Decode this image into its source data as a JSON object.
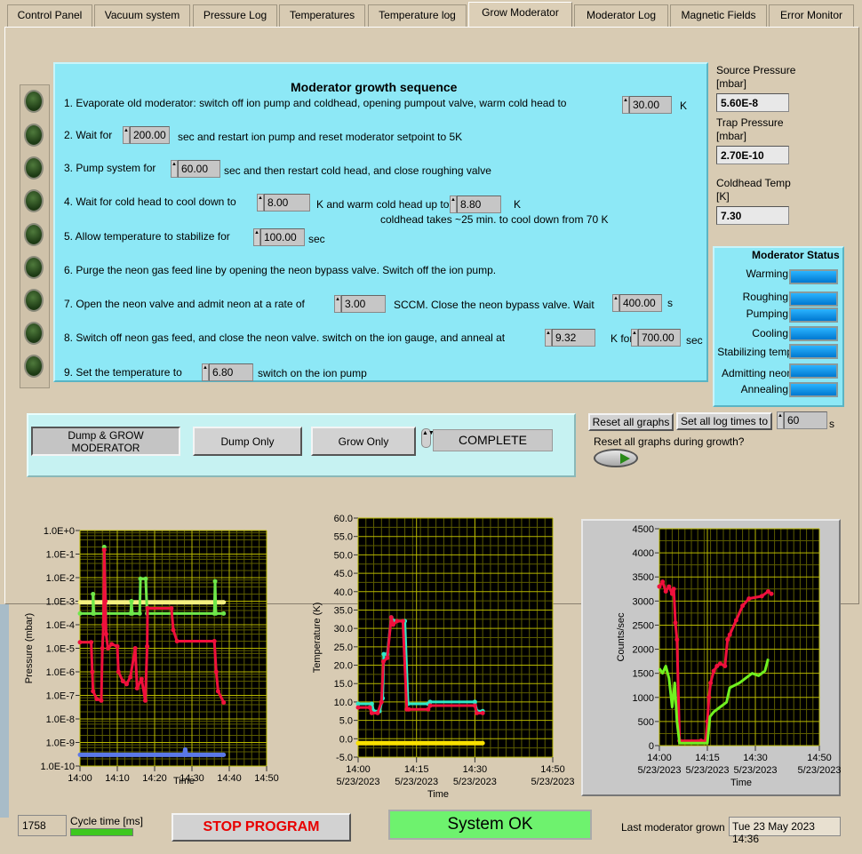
{
  "tabs": [
    "Control Panel",
    "Vacuum system",
    "Pressure Log",
    "Temperatures",
    "Temperature log",
    "Grow Moderator",
    "Moderator Log",
    "Magnetic Fields",
    "Error Monitor"
  ],
  "selected_tab": "Grow Moderator",
  "sequence": {
    "title": "Moderator growth sequence",
    "s1": {
      "text": "1. Evaporate old moderator: switch off ion pump and coldhead,  opening pumpout valve,  warm cold head to",
      "value": "30.00",
      "unit": "K"
    },
    "s2": {
      "text": "2. Wait for",
      "value": "200.00",
      "after": "sec and restart ion pump and reset moderator setpoint to 5K"
    },
    "s3": {
      "text": "3. Pump system for",
      "value": "60.00",
      "after": "sec and then restart cold head, and close roughing valve"
    },
    "s4": {
      "text": "4. Wait for cold head to cool down to",
      "value": "8.00",
      "mid": "K and warm cold head up to",
      "value2": "8.80",
      "unit": "K",
      "note": "coldhead takes ~25 min. to cool down from 70 K"
    },
    "s5": {
      "text": "5. Allow temperature to stabilize for",
      "value": "100.00",
      "unit": "sec"
    },
    "s6": {
      "text": "6. Purge the neon gas feed line by opening the neon bypass valve. Switch off the ion pump."
    },
    "s7": {
      "text": "7. Open the neon  valve and admit neon at a rate of",
      "value": "3.00",
      "mid": "SCCM. Close the neon bypass valve. Wait",
      "value2": "400.00",
      "unit": "s"
    },
    "s8": {
      "text": "8. Switch off neon gas feed, and close the neon valve. switch on the ion gauge, and anneal at",
      "value": "9.32",
      "mid": "K for",
      "value2": "700.00",
      "unit": "sec"
    },
    "s9": {
      "text": "9. Set the temperature to",
      "value": "6.80",
      "after": "switch on the ion pump"
    }
  },
  "readouts": {
    "source_label": "Source Pressure [mbar]",
    "source_value": "5.60E-8",
    "trap_label": "Trap Pressure [mbar]",
    "trap_value": "2.70E-10",
    "coldhead_label": "Coldhead Temp [K]",
    "coldhead_value": "7.30"
  },
  "status": {
    "title": "Moderator Status",
    "items": [
      "Warming",
      "Roughing",
      "Pumping",
      "Cooling",
      "Stabilizing temp",
      "Admitting neon",
      "Annealing"
    ],
    "color": "#1a9cf0"
  },
  "controls": {
    "dump_grow": "Dump & GROW MODERATOR",
    "dump_only": "Dump Only",
    "grow_only": "Grow Only",
    "state": "COMPLETE",
    "reset_graphs": "Reset  all graphs",
    "set_log_times": "Set all log times to",
    "log_time": "60",
    "log_unit": "s",
    "reset_during_growth": "Reset all graphs during growth?"
  },
  "footer": {
    "cycle_value": "1758",
    "cycle_label": "Cycle time [ms]",
    "stop": "STOP PROGRAM",
    "system_status": "System OK",
    "last_label": "Last moderator grown",
    "last_value": "Tue 23 May 2023 14:36"
  },
  "chart_data": [
    {
      "type": "line",
      "ylabel": "Pressure (mbar)",
      "xlabel": "Time",
      "yscale": "log",
      "ylim": [
        1e-10,
        1
      ],
      "xlim": [
        0,
        50
      ],
      "xticks": [
        "14:00",
        "14:10",
        "14:20",
        "14:30",
        "14:40",
        "14:50"
      ],
      "yticks": [
        "1.0E-10",
        "1.0E-9",
        "1.0E-8",
        "1.0E-7",
        "1.0E-6",
        "1.0E-5",
        "1.0E-4",
        "1.0E-3",
        "1.0E-2",
        "1.0E-1",
        "1.0E+0"
      ],
      "x_unit": "minutes after 14:00",
      "series": [
        {
          "name": "yellow",
          "color": "#f4f080",
          "points": [
            [
              0,
              0.0009
            ],
            [
              38.5,
              0.0009
            ]
          ]
        },
        {
          "name": "green",
          "color": "#6ee84a",
          "points": [
            [
              0,
              0.0003
            ],
            [
              3.5,
              0.0003
            ],
            [
              3.5,
              0.002
            ],
            [
              3.7,
              0.0003
            ],
            [
              6.4,
              0.0003
            ],
            [
              6.5,
              0.2
            ],
            [
              6.9,
              0.0003
            ],
            [
              13.6,
              0.0003
            ],
            [
              13.8,
              0.001
            ],
            [
              14,
              0.0003
            ],
            [
              16,
              0.0003
            ],
            [
              16.2,
              0.009
            ],
            [
              17.6,
              0.009
            ],
            [
              18,
              0.0003
            ],
            [
              36,
              0.0003
            ],
            [
              36.2,
              0.007
            ],
            [
              36.4,
              0.0003
            ],
            [
              38.5,
              0.0003
            ]
          ]
        },
        {
          "name": "red",
          "color": "#f0103c",
          "points": [
            [
              0,
              1.8e-05
            ],
            [
              3,
              1.8e-05
            ],
            [
              3.3,
              1e-06
            ],
            [
              3.5,
              1.5e-07
            ],
            [
              4.5,
              7e-08
            ],
            [
              5.7,
              6e-08
            ],
            [
              6,
              1e-05
            ],
            [
              6.3,
              0.0001
            ],
            [
              6.5,
              0.15
            ],
            [
              6.8,
              0.001
            ],
            [
              7,
              4e-05
            ],
            [
              7.5,
              1e-05
            ],
            [
              8.5,
              1.5e-05
            ],
            [
              10,
              1.2e-05
            ],
            [
              10.3,
              1e-06
            ],
            [
              11.5,
              4e-07
            ],
            [
              12.5,
              3e-07
            ],
            [
              13.5,
              6e-07
            ],
            [
              14.8,
              1e-05
            ],
            [
              15.3,
              2e-07
            ],
            [
              16.5,
              5e-07
            ],
            [
              17.5,
              6e-08
            ],
            [
              18,
              1.2e-05
            ],
            [
              18.1,
              0.0005
            ],
            [
              24.5,
              0.0005
            ],
            [
              25,
              6e-05
            ],
            [
              26,
              2e-05
            ],
            [
              36,
              2e-05
            ],
            [
              36.5,
              1e-06
            ],
            [
              37,
              1.5e-07
            ],
            [
              38.5,
              5e-08
            ]
          ]
        },
        {
          "name": "blue",
          "color": "#5a78e8",
          "points": [
            [
              0,
              3e-10
            ],
            [
              28,
              3e-10
            ],
            [
              28.2,
              5e-10
            ],
            [
              28.4,
              3e-10
            ],
            [
              38.5,
              3e-10
            ]
          ]
        }
      ]
    },
    {
      "type": "line",
      "ylabel": "Temperature (K)",
      "xlabel": "Time",
      "ylim": [
        -5,
        60
      ],
      "xlim": [
        0,
        50
      ],
      "xticks": [
        {
          "v": 0,
          "t": "14:00",
          "d": "5/23/2023"
        },
        {
          "v": 15,
          "t": "14:15",
          "d": "5/23/2023"
        },
        {
          "v": 30,
          "t": "14:30",
          "d": "5/23/2023"
        },
        {
          "v": 50,
          "t": "14:50",
          "d": "5/23/2023"
        }
      ],
      "yticks": [
        "-5.0",
        "0.0",
        "5.0",
        "10.0",
        "15.0",
        "20.0",
        "25.0",
        "30.0",
        "35.0",
        "40.0",
        "45.0",
        "50.0",
        "55.0",
        "60.0"
      ],
      "series": [
        {
          "name": "cyan",
          "color": "#30e8c8",
          "points": [
            [
              0,
              9.5
            ],
            [
              3.5,
              9.5
            ],
            [
              4,
              7.5
            ],
            [
              5.5,
              7.5
            ],
            [
              6.3,
              11
            ],
            [
              6.6,
              23
            ],
            [
              7.5,
              23
            ],
            [
              8.5,
              33
            ],
            [
              9.2,
              32
            ],
            [
              12,
              32
            ],
            [
              12.8,
              9.5
            ],
            [
              18,
              9.5
            ],
            [
              18.5,
              10
            ],
            [
              30,
              10
            ],
            [
              30.5,
              7.5
            ],
            [
              32,
              7.5
            ]
          ]
        },
        {
          "name": "red",
          "color": "#f0103c",
          "points": [
            [
              0,
              8.5
            ],
            [
              3,
              8.5
            ],
            [
              3.5,
              7
            ],
            [
              5,
              7
            ],
            [
              6,
              10
            ],
            [
              6.5,
              21
            ],
            [
              7.5,
              22
            ],
            [
              8.5,
              33
            ],
            [
              9,
              31
            ],
            [
              10,
              32
            ],
            [
              11.5,
              32
            ],
            [
              12.5,
              8
            ],
            [
              13,
              8
            ],
            [
              18,
              8
            ],
            [
              18.5,
              9
            ],
            [
              30,
              9
            ],
            [
              30.5,
              7
            ],
            [
              32,
              7
            ]
          ]
        },
        {
          "name": "yellow",
          "color": "#f8e000",
          "points": [
            [
              0,
              -1.2
            ],
            [
              32,
              -1.2
            ]
          ]
        }
      ]
    },
    {
      "type": "line",
      "ylabel": "Counts/sec",
      "xlabel": "Time",
      "ylim": [
        0,
        4500
      ],
      "xlim": [
        0,
        50
      ],
      "xticks": [
        {
          "v": 0,
          "t": "14:00",
          "d": "5/23/2023"
        },
        {
          "v": 15,
          "t": "14:15",
          "d": "5/23/2023"
        },
        {
          "v": 30,
          "t": "14:30",
          "d": "5/23/2023"
        },
        {
          "v": 50,
          "t": "14:50",
          "d": "5/23/2023"
        }
      ],
      "yticks": [
        "0",
        "500",
        "1000",
        "1500",
        "2000",
        "2500",
        "3000",
        "3500",
        "4000",
        "4500"
      ],
      "series": [
        {
          "name": "red",
          "color": "#f0103c",
          "points": [
            [
              0,
              3300
            ],
            [
              1,
              3400
            ],
            [
              2,
              3200
            ],
            [
              3,
              3300
            ],
            [
              4,
              3150
            ],
            [
              4.5,
              3250
            ],
            [
              5,
              2550
            ],
            [
              5.5,
              2200
            ],
            [
              6.3,
              100
            ],
            [
              13,
              100
            ],
            [
              14.5,
              100
            ],
            [
              15,
              500
            ],
            [
              15.5,
              1000
            ],
            [
              16,
              1300
            ],
            [
              17,
              1550
            ],
            [
              18,
              1650
            ],
            [
              19,
              1700
            ],
            [
              20.5,
              1650
            ],
            [
              21.3,
              2200
            ],
            [
              22,
              2300
            ],
            [
              24,
              2600
            ],
            [
              26,
              2900
            ],
            [
              28,
              3050
            ],
            [
              32,
              3100
            ],
            [
              34,
              3200
            ],
            [
              35,
              3150
            ]
          ]
        },
        {
          "name": "green",
          "color": "#70f020",
          "points": [
            [
              0,
              1600
            ],
            [
              1,
              1500
            ],
            [
              2,
              1650
            ],
            [
              3,
              1400
            ],
            [
              4,
              800
            ],
            [
              4.8,
              1300
            ],
            [
              5.5,
              500
            ],
            [
              6.3,
              50
            ],
            [
              15,
              50
            ],
            [
              15.8,
              600
            ],
            [
              17,
              700
            ],
            [
              19,
              800
            ],
            [
              21,
              900
            ],
            [
              22,
              1200
            ],
            [
              25,
              1300
            ],
            [
              27,
              1400
            ],
            [
              29,
              1500
            ],
            [
              31,
              1450
            ],
            [
              33,
              1550
            ],
            [
              34,
              1800
            ]
          ]
        }
      ]
    }
  ]
}
